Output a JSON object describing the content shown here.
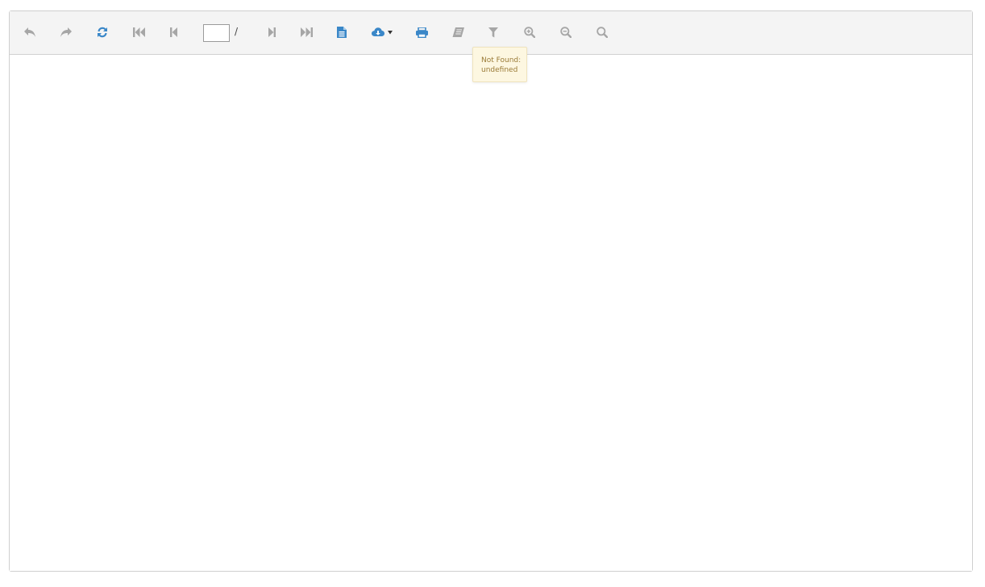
{
  "toolbar": {
    "page_input_value": "",
    "page_separator": "/",
    "buttons": [
      {
        "name": "undo-button",
        "icon": "undo-icon",
        "state": "disabled"
      },
      {
        "name": "redo-button",
        "icon": "redo-icon",
        "state": "disabled"
      },
      {
        "name": "refresh-button",
        "icon": "refresh-icon",
        "state": "enabled"
      },
      {
        "name": "first-page-button",
        "icon": "first-page-icon",
        "state": "disabled"
      },
      {
        "name": "previous-page-button",
        "icon": "previous-page-icon",
        "state": "disabled"
      },
      {
        "name": "next-page-button",
        "icon": "next-page-icon",
        "state": "disabled"
      },
      {
        "name": "last-page-button",
        "icon": "last-page-icon",
        "state": "disabled"
      },
      {
        "name": "document-map-button",
        "icon": "document-icon",
        "state": "enabled"
      },
      {
        "name": "export-button",
        "icon": "cloud-download-icon",
        "state": "enabled"
      },
      {
        "name": "print-button",
        "icon": "print-icon",
        "state": "enabled"
      },
      {
        "name": "print-preview-button",
        "icon": "book-icon",
        "state": "disabled"
      },
      {
        "name": "parameters-button",
        "icon": "filter-icon",
        "state": "disabled"
      },
      {
        "name": "zoom-in-button",
        "icon": "zoom-in-icon",
        "state": "disabled"
      },
      {
        "name": "zoom-out-button",
        "icon": "zoom-out-icon",
        "state": "disabled"
      },
      {
        "name": "search-button",
        "icon": "search-icon",
        "state": "disabled"
      }
    ]
  },
  "tooltip": {
    "line1": "Not Found:",
    "line2": "undefined"
  },
  "colors": {
    "enabled_icon": "#3a87c8",
    "disabled_icon": "#a6a6a6",
    "toolbar_bg": "#f4f4f4",
    "tooltip_bg": "#fdf7e1",
    "tooltip_text": "#9a7a36"
  }
}
